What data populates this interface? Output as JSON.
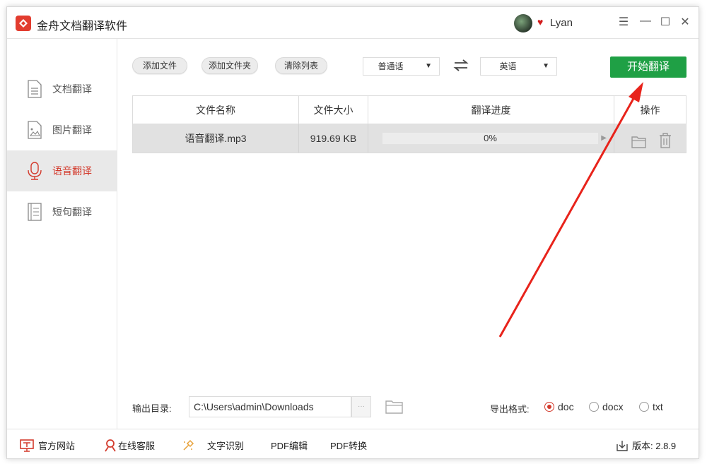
{
  "app": {
    "title": "金舟文档翻译软件"
  },
  "user": {
    "name": "Lyan"
  },
  "window_controls": {
    "menu": "☰",
    "minimize": "—",
    "maximize": "☐",
    "close": "✕"
  },
  "sidebar": {
    "items": [
      {
        "label": "文档翻译",
        "icon": "document-icon",
        "active": false
      },
      {
        "label": "图片翻译",
        "icon": "image-icon",
        "active": false
      },
      {
        "label": "语音翻译",
        "icon": "microphone-icon",
        "active": true
      },
      {
        "label": "短句翻译",
        "icon": "sentence-icon",
        "active": false
      }
    ]
  },
  "toolbar": {
    "add_file": "添加文件",
    "add_folder": "添加文件夹",
    "clear_list": "清除列表",
    "source_lang": "普通话",
    "target_lang": "英语",
    "start": "开始翻译"
  },
  "table": {
    "headers": {
      "name": "文件名称",
      "size": "文件大小",
      "progress": "翻译进度",
      "action": "操作"
    },
    "rows": [
      {
        "name": "语音翻译.mp3",
        "size": "919.69 KB",
        "progress_text": "0%",
        "progress_fraction": 0
      }
    ]
  },
  "output": {
    "label": "输出目录:",
    "path": "C:\\Users\\admin\\Downloads",
    "browse": "···",
    "format_label": "导出格式:",
    "formats": [
      {
        "label": "doc",
        "selected": true
      },
      {
        "label": "docx",
        "selected": false
      },
      {
        "label": "txt",
        "selected": false
      }
    ]
  },
  "statusbar": {
    "website": "官方网站",
    "support": "在线客服",
    "ocr": "文字识别",
    "pdf_edit": "PDF编辑",
    "pdf_convert": "PDF转换",
    "version": "版本: 2.8.9"
  },
  "colors": {
    "accent": "#d33a2c",
    "start_button": "#1fa045",
    "annotation_arrow": "#e8231b"
  }
}
